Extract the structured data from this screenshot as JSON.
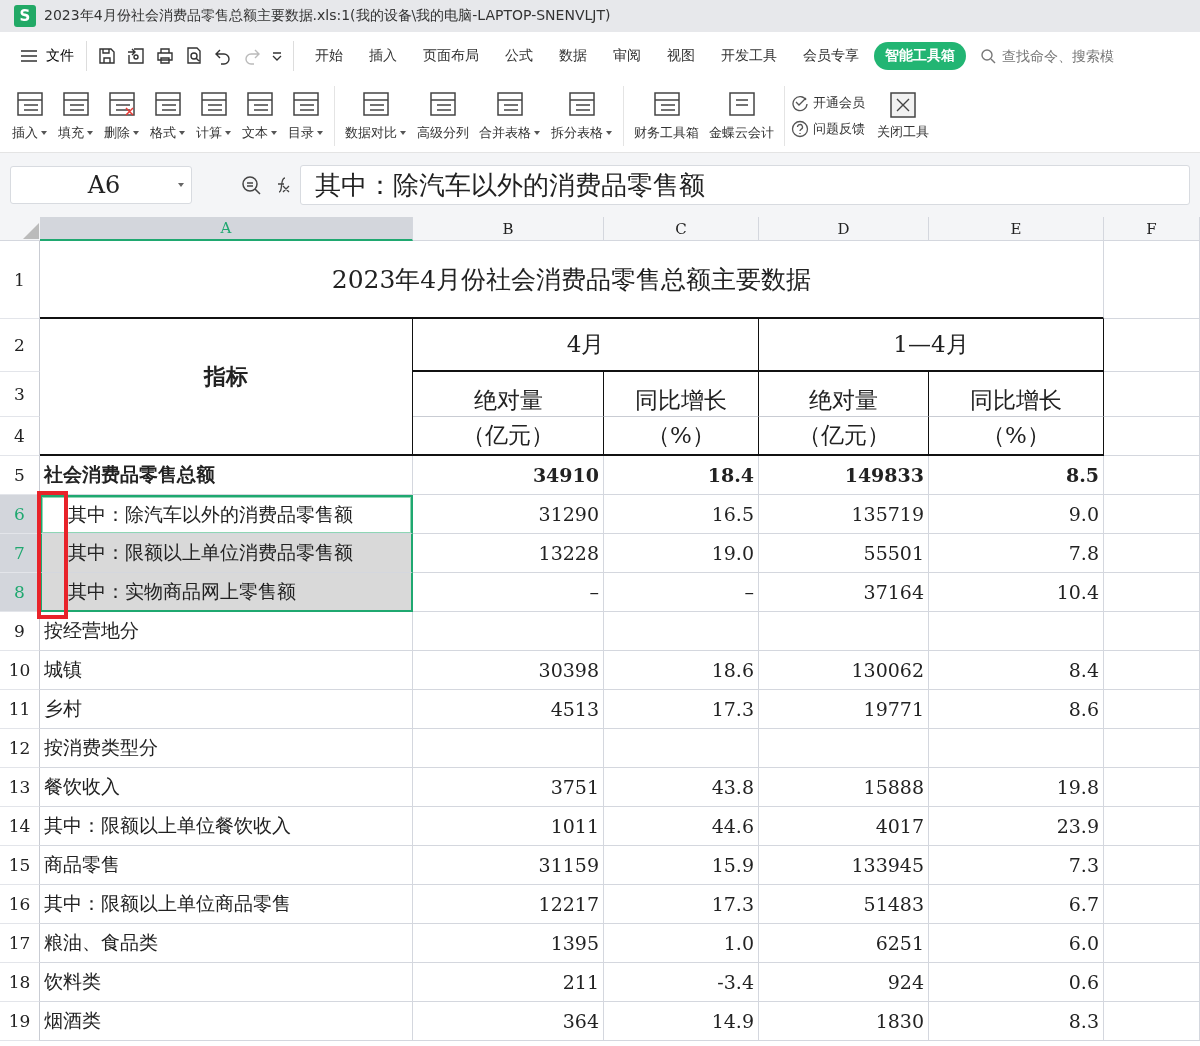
{
  "title_bar": {
    "app_icon": "S",
    "title": "2023年4月份社会消费品零售总额主要数据.xls:1(我的设备\\我的电脑-LAPTOP-SNENVLJT)"
  },
  "menu": {
    "file": "文件",
    "tabs": [
      {
        "label": "开始",
        "selected": false
      },
      {
        "label": "插入",
        "selected": false
      },
      {
        "label": "页面布局",
        "selected": false
      },
      {
        "label": "公式",
        "selected": false
      },
      {
        "label": "数据",
        "selected": false
      },
      {
        "label": "审阅",
        "selected": false
      },
      {
        "label": "视图",
        "selected": false
      },
      {
        "label": "开发工具",
        "selected": false
      },
      {
        "label": "会员专享",
        "selected": false
      },
      {
        "label": "智能工具箱",
        "selected": true
      }
    ],
    "search": {
      "placeholder": "查找命令、搜索模"
    }
  },
  "ribbon": {
    "groups": [
      {
        "buttons": [
          {
            "label": "插入",
            "dropdown": true
          },
          {
            "label": "填充",
            "dropdown": true
          },
          {
            "label": "删除",
            "dropdown": true
          },
          {
            "label": "格式",
            "dropdown": true
          },
          {
            "label": "计算",
            "dropdown": true
          },
          {
            "label": "文本",
            "dropdown": true
          },
          {
            "label": "目录",
            "dropdown": true
          }
        ]
      },
      {
        "buttons": [
          {
            "label": "数据对比",
            "dropdown": true
          },
          {
            "label": "高级分列",
            "dropdown": false
          },
          {
            "label": "合并表格",
            "dropdown": true
          },
          {
            "label": "拆分表格",
            "dropdown": true
          }
        ]
      },
      {
        "buttons": [
          {
            "label": "财务工具箱",
            "dropdown": false
          },
          {
            "label": "金蝶云会计",
            "dropdown": false
          }
        ]
      }
    ],
    "links": [
      "开通会员",
      "问题反馈"
    ],
    "close_tool": "关闭工具"
  },
  "formula_bar": {
    "cell_ref": "A6",
    "formula": "其中：除汽车以外的消费品零售额"
  },
  "sheet": {
    "columns": [
      {
        "label": "A",
        "selected": true
      },
      {
        "label": "B",
        "selected": false
      },
      {
        "label": "C",
        "selected": false
      },
      {
        "label": "D",
        "selected": false
      },
      {
        "label": "E",
        "selected": false
      },
      {
        "label": "F",
        "selected": false
      }
    ],
    "title_row": {
      "number": "1",
      "text": "2023年4月份社会消费品零售总额主要数据"
    },
    "header": {
      "row_numbers": [
        "2",
        "3",
        "4"
      ],
      "indicator": "指标",
      "periods": [
        {
          "label": "4月",
          "columns": [
            {
              "name": "绝对量",
              "unit": "（亿元）"
            },
            {
              "name": "同比增长",
              "unit": "（%）"
            }
          ]
        },
        {
          "label": "1—4月",
          "columns": [
            {
              "name": "绝对量",
              "unit": "（亿元）"
            },
            {
              "name": "同比增长",
              "unit": "（%）"
            }
          ]
        }
      ]
    },
    "rows": [
      {
        "number": "5",
        "selected": false,
        "active": false,
        "bold": true,
        "indent": false,
        "label": "社会消费品零售总额",
        "values": [
          "34910",
          "18.4",
          "149833",
          "8.5"
        ]
      },
      {
        "number": "6",
        "selected": true,
        "active": true,
        "bold": false,
        "indent": true,
        "label": "其中：除汽车以外的消费品零售额",
        "values": [
          "31290",
          "16.5",
          "135719",
          "9.0"
        ]
      },
      {
        "number": "7",
        "selected": true,
        "active": false,
        "bold": false,
        "indent": true,
        "label": "其中：限额以上单位消费品零售额",
        "values": [
          "13228",
          "19.0",
          "55501",
          "7.8"
        ]
      },
      {
        "number": "8",
        "selected": true,
        "active": false,
        "bold": false,
        "indent": true,
        "label": "其中：实物商品网上零售额",
        "values": [
          "–",
          "–",
          "37164",
          "10.4"
        ]
      },
      {
        "number": "9",
        "selected": false,
        "active": false,
        "bold": false,
        "indent": false,
        "label": "按经营地分"
      },
      {
        "number": "10",
        "selected": false,
        "active": false,
        "bold": false,
        "indent": false,
        "label": "城镇",
        "values": [
          "30398",
          "18.6",
          "130062",
          "8.4"
        ]
      },
      {
        "number": "11",
        "selected": false,
        "active": false,
        "bold": false,
        "indent": false,
        "label": "乡村",
        "values": [
          "4513",
          "17.3",
          "19771",
          "8.6"
        ]
      },
      {
        "number": "12",
        "selected": false,
        "active": false,
        "bold": false,
        "indent": false,
        "label": "按消费类型分"
      },
      {
        "number": "13",
        "selected": false,
        "active": false,
        "bold": false,
        "indent": false,
        "label": "餐饮收入",
        "values": [
          "3751",
          "43.8",
          "15888",
          "19.8"
        ]
      },
      {
        "number": "14",
        "selected": false,
        "active": false,
        "bold": false,
        "indent": false,
        "label": "其中：限额以上单位餐饮收入",
        "values": [
          "1011",
          "44.6",
          "4017",
          "23.9"
        ]
      },
      {
        "number": "15",
        "selected": false,
        "active": false,
        "bold": false,
        "indent": false,
        "label": "商品零售",
        "values": [
          "31159",
          "15.9",
          "133945",
          "7.3"
        ]
      },
      {
        "number": "16",
        "selected": false,
        "active": false,
        "bold": false,
        "indent": false,
        "label": "其中：限额以上单位商品零售",
        "values": [
          "12217",
          "17.3",
          "51483",
          "6.7"
        ]
      },
      {
        "number": "17",
        "selected": false,
        "active": false,
        "bold": false,
        "indent": false,
        "label": "粮油、食品类",
        "values": [
          "1395",
          "1.0",
          "6251",
          "6.0"
        ]
      },
      {
        "number": "18",
        "selected": false,
        "active": false,
        "bold": false,
        "indent": false,
        "label": "饮料类",
        "values": [
          "211",
          "-3.4",
          "924",
          "0.6"
        ]
      },
      {
        "number": "19",
        "selected": false,
        "active": false,
        "bold": false,
        "indent": false,
        "label": "烟酒类",
        "values": [
          "364",
          "14.9",
          "1830",
          "8.3"
        ]
      }
    ]
  }
}
